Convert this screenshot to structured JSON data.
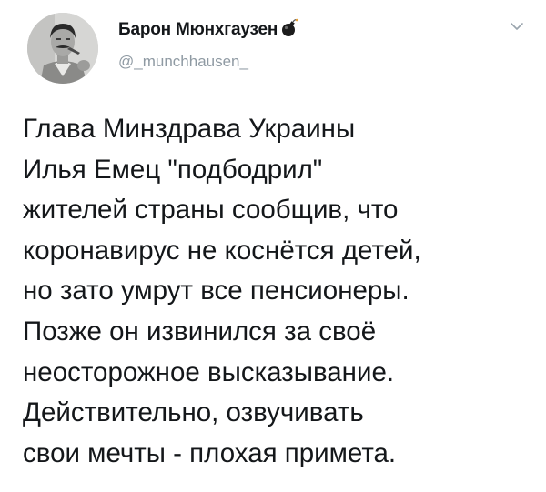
{
  "tweet": {
    "author": {
      "display_name": "Барон Мюнхгаузен",
      "handle": "@_munchhausen_",
      "badge_icon": "bomb-icon",
      "avatar_icon": "avatar-photo"
    },
    "menu_icon": "chevron-down-icon",
    "text_lines": [
      "Глава Минздрава Украины",
      "Илья Емец \"подбодрил\"",
      "жителей страны сообщив, что",
      "коронавирус не коснётся детей,",
      "но зато умрут все пенсионеры.",
      "Позже он извинился за своё",
      "неосторожное высказывание.",
      "Действительно, озвучивать",
      "свои мечты - плохая примета."
    ]
  },
  "colors": {
    "text": "#14171a",
    "handle": "#8f9aa3",
    "background": "#ffffff",
    "chevron": "#9aa4ad"
  }
}
